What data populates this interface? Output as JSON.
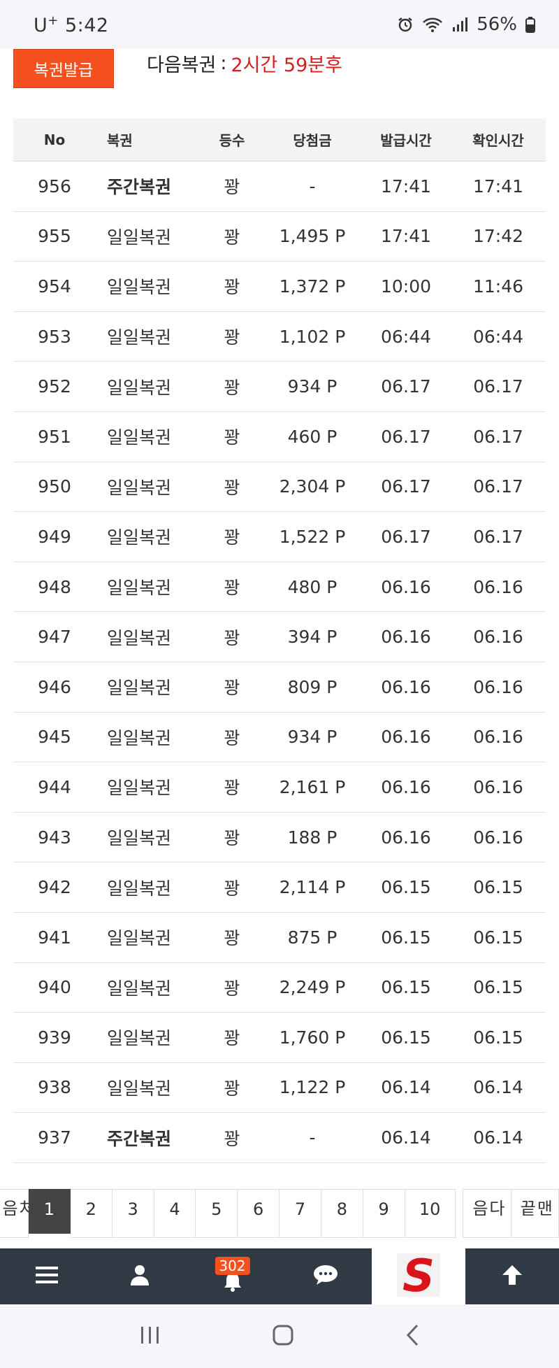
{
  "status_bar": {
    "carrier": "U",
    "carrier_sup": "+",
    "time": "5:42",
    "battery": "56%"
  },
  "header": {
    "issue_button": "복권발급",
    "next_label": "다음복권",
    "next_colon": ":",
    "next_time": "2시간 59분후"
  },
  "table": {
    "columns": [
      "No",
      "복권",
      "등수",
      "당첨금",
      "발급시간",
      "확인시간"
    ],
    "rows": [
      {
        "no": "956",
        "type": "주간복권",
        "bold": true,
        "rank": "꽝",
        "prize": "-",
        "issued": "17:41",
        "checked": "17:41"
      },
      {
        "no": "955",
        "type": "일일복권",
        "bold": false,
        "rank": "꽝",
        "prize": "1,495 P",
        "issued": "17:41",
        "checked": "17:42"
      },
      {
        "no": "954",
        "type": "일일복권",
        "bold": false,
        "rank": "꽝",
        "prize": "1,372 P",
        "issued": "10:00",
        "checked": "11:46"
      },
      {
        "no": "953",
        "type": "일일복권",
        "bold": false,
        "rank": "꽝",
        "prize": "1,102 P",
        "issued": "06:44",
        "checked": "06:44"
      },
      {
        "no": "952",
        "type": "일일복권",
        "bold": false,
        "rank": "꽝",
        "prize": "934 P",
        "issued": "06.17",
        "checked": "06.17"
      },
      {
        "no": "951",
        "type": "일일복권",
        "bold": false,
        "rank": "꽝",
        "prize": "460 P",
        "issued": "06.17",
        "checked": "06.17"
      },
      {
        "no": "950",
        "type": "일일복권",
        "bold": false,
        "rank": "꽝",
        "prize": "2,304 P",
        "issued": "06.17",
        "checked": "06.17"
      },
      {
        "no": "949",
        "type": "일일복권",
        "bold": false,
        "rank": "꽝",
        "prize": "1,522 P",
        "issued": "06.17",
        "checked": "06.17"
      },
      {
        "no": "948",
        "type": "일일복권",
        "bold": false,
        "rank": "꽝",
        "prize": "480 P",
        "issued": "06.16",
        "checked": "06.16"
      },
      {
        "no": "947",
        "type": "일일복권",
        "bold": false,
        "rank": "꽝",
        "prize": "394 P",
        "issued": "06.16",
        "checked": "06.16"
      },
      {
        "no": "946",
        "type": "일일복권",
        "bold": false,
        "rank": "꽝",
        "prize": "809 P",
        "issued": "06.16",
        "checked": "06.16"
      },
      {
        "no": "945",
        "type": "일일복권",
        "bold": false,
        "rank": "꽝",
        "prize": "934 P",
        "issued": "06.16",
        "checked": "06.16"
      },
      {
        "no": "944",
        "type": "일일복권",
        "bold": false,
        "rank": "꽝",
        "prize": "2,161 P",
        "issued": "06.16",
        "checked": "06.16"
      },
      {
        "no": "943",
        "type": "일일복권",
        "bold": false,
        "rank": "꽝",
        "prize": "188 P",
        "issued": "06.16",
        "checked": "06.16"
      },
      {
        "no": "942",
        "type": "일일복권",
        "bold": false,
        "rank": "꽝",
        "prize": "2,114 P",
        "issued": "06.15",
        "checked": "06.15"
      },
      {
        "no": "941",
        "type": "일일복권",
        "bold": false,
        "rank": "꽝",
        "prize": "875 P",
        "issued": "06.15",
        "checked": "06.15"
      },
      {
        "no": "940",
        "type": "일일복권",
        "bold": false,
        "rank": "꽝",
        "prize": "2,249 P",
        "issued": "06.15",
        "checked": "06.15"
      },
      {
        "no": "939",
        "type": "일일복권",
        "bold": false,
        "rank": "꽝",
        "prize": "1,760 P",
        "issued": "06.15",
        "checked": "06.15"
      },
      {
        "no": "938",
        "type": "일일복권",
        "bold": false,
        "rank": "꽝",
        "prize": "1,122 P",
        "issued": "06.14",
        "checked": "06.14"
      },
      {
        "no": "937",
        "type": "주간복권",
        "bold": true,
        "rank": "꽝",
        "prize": "-",
        "issued": "06.14",
        "checked": "06.14"
      }
    ]
  },
  "pagination": {
    "first": "처음",
    "pages": [
      "1",
      "2",
      "3",
      "4",
      "5",
      "6",
      "7",
      "8",
      "9",
      "10"
    ],
    "active": "1",
    "next": "다음",
    "last": "맨끝"
  },
  "bottom_nav": {
    "items": [
      "menu-icon",
      "user-icon",
      "bell-icon",
      "chat-icon",
      "logo",
      "arrow-up-icon"
    ],
    "notification_count": "302",
    "logo_letter": "S"
  },
  "colors": {
    "accent": "#f4511e",
    "next_time": "#d62020",
    "nav_bg": "#2f3a45",
    "active_page": "#444444"
  }
}
